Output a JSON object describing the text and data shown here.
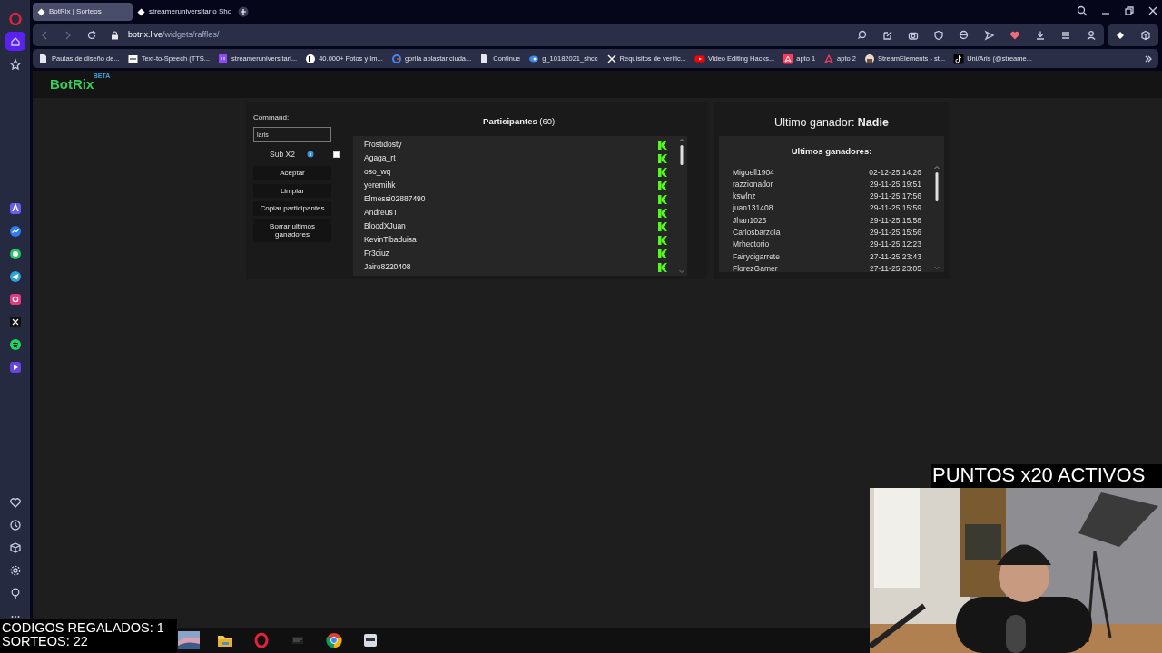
{
  "browser": {
    "tabs": [
      {
        "title": "BotRix | Sorteos",
        "selected": true
      },
      {
        "title": "streameruniversitario Sho",
        "selected": false
      }
    ],
    "address": {
      "domain": "botrix.live",
      "path": "/widgets/raffles/"
    },
    "bookmarks": [
      {
        "label": "Pautas de diseño de...",
        "kind": "doc"
      },
      {
        "label": "Text-to-Speech (TTS...",
        "kind": "tts"
      },
      {
        "label": "streameruniversitari...",
        "kind": "twitch"
      },
      {
        "label": "40.000+ Fotos y Im..."
      },
      {
        "label": "gorila aplastar ciuda...",
        "kind": "google"
      },
      {
        "label": "Continue",
        "kind": "doc"
      },
      {
        "label": "g_10182021_shcc",
        "kind": "edge"
      },
      {
        "label": "Requisitos de verific...",
        "kind": "x"
      },
      {
        "label": "Video Editing Hacks...",
        "kind": "youtube"
      },
      {
        "label": "apto 1",
        "kind": "airbnb"
      },
      {
        "label": "apto 2",
        "kind": "airbnb-outline"
      },
      {
        "label": "StreamElements - st...",
        "kind": "stream"
      },
      {
        "label": "Uni/Aris (@streame...",
        "kind": "tiktok"
      }
    ]
  },
  "sidebar": {
    "items": [
      {
        "kind": "home",
        "selected": true
      },
      {
        "kind": "star",
        "selected": false
      }
    ]
  },
  "brand": {
    "name": "BotRix",
    "badge": "BETA"
  },
  "raffle": {
    "command_label": "Command:",
    "command": "laris",
    "sub_x2": {
      "label": "Sub X2",
      "checked": false
    },
    "buttons": [
      "Aceptar",
      "Limpiar",
      "Copiar participantes",
      "Borrar ultimos ganadores"
    ],
    "participants_heading": "**Participantes** (60):",
    "participants": [
      "Frostidosty",
      "Agaga_rt",
      "oso_wq",
      "yeremihk",
      "Elmessi02887490",
      "AndreusT",
      "BloodXJuan",
      "KevinTibaduisa",
      "Fr3ciuz",
      "Jairo8220408"
    ]
  },
  "winner": {
    "text": "Ultimo ganador: **Nadie**",
    "recent_heading": "Ultimos ganadores:",
    "recent": [
      {
        "name": "Miguell1904",
        "date": "02-12-25 14:26"
      },
      {
        "name": "razzionador",
        "date": "29-11-25 19:51"
      },
      {
        "name": "kswlnz",
        "date": "29-11-25 17:56"
      },
      {
        "name": "juan131408",
        "date": "29-11-25 15:59"
      },
      {
        "name": "Jhan1025",
        "date": "29-11-25 15:58"
      },
      {
        "name": "Carlosbarzola",
        "date": "29-11-25 15:56"
      },
      {
        "name": "Mrhectorio",
        "date": "29-11-25 12:23"
      },
      {
        "name": "Fairycigarrete",
        "date": "27-11-25 23:43"
      },
      {
        "name": "FlorezGamer",
        "date": "27-11-25 23:05"
      }
    ]
  },
  "overlays": {
    "counters": [
      "CODIGOS REGALADOS: 1",
      "SORTEOS: 22"
    ],
    "banner": "PUNTOS x20 ACTIVOS"
  }
}
